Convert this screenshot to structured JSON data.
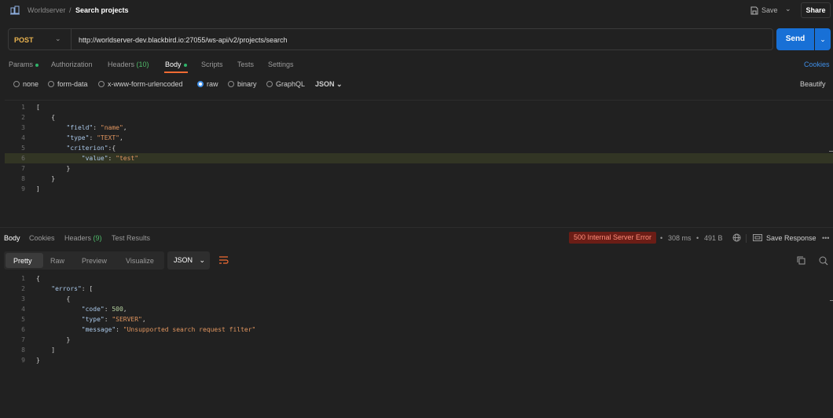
{
  "header": {
    "workspace": "Worldserver",
    "separator": "/",
    "title": "Search projects",
    "save_label": "Save",
    "share_label": "Share"
  },
  "request": {
    "method": "POST",
    "url": "http://worldserver-dev.blackbird.io:27055/ws-api/v2/projects/search",
    "send_label": "Send"
  },
  "request_tabs": {
    "params": "Params",
    "authorization": "Authorization",
    "headers": "Headers",
    "headers_count": "(10)",
    "body": "Body",
    "scripts": "Scripts",
    "tests": "Tests",
    "settings": "Settings",
    "cookies": "Cookies"
  },
  "body_types": {
    "none": "none",
    "form_data": "form-data",
    "urlencoded": "x-www-form-urlencoded",
    "raw": "raw",
    "binary": "binary",
    "graphql": "GraphQL",
    "format": "JSON",
    "beautify": "Beautify"
  },
  "request_body_lines": [
    {
      "n": "1",
      "t": "["
    },
    {
      "n": "2",
      "t": "    {"
    },
    {
      "n": "3",
      "t": "        \"field\": \"name\","
    },
    {
      "n": "4",
      "t": "        \"type\": \"TEXT\","
    },
    {
      "n": "5",
      "t": "        \"criterion\":{"
    },
    {
      "n": "6",
      "t": "            \"value\": \"test\""
    },
    {
      "n": "7",
      "t": "        }"
    },
    {
      "n": "8",
      "t": "    }"
    },
    {
      "n": "9",
      "t": "]"
    }
  ],
  "response_tabs": {
    "body": "Body",
    "cookies": "Cookies",
    "headers": "Headers",
    "headers_count": "(9)",
    "test_results": "Test Results"
  },
  "response_meta": {
    "status": "500 Internal Server Error",
    "time": "308 ms",
    "size": "491 B",
    "save_response": "Save Response"
  },
  "view_tabs": {
    "pretty": "Pretty",
    "raw": "Raw",
    "preview": "Preview",
    "visualize": "Visualize",
    "format": "JSON"
  },
  "response_body_lines": [
    {
      "n": "1",
      "t": "{"
    },
    {
      "n": "2",
      "t": "    \"errors\": ["
    },
    {
      "n": "3",
      "t": "        {"
    },
    {
      "n": "4",
      "t": "            \"code\": 500,"
    },
    {
      "n": "5",
      "t": "            \"type\": \"SERVER\","
    },
    {
      "n": "6",
      "t": "            \"message\": \"Unsupported search request filter\""
    },
    {
      "n": "7",
      "t": "        }"
    },
    {
      "n": "8",
      "t": "    ]"
    },
    {
      "n": "9",
      "t": "}"
    }
  ],
  "colors": {
    "accent": "#1870d6",
    "method": "#e9b34f",
    "error_bg": "#6b1d16",
    "tab_underline": "#f06b33"
  }
}
